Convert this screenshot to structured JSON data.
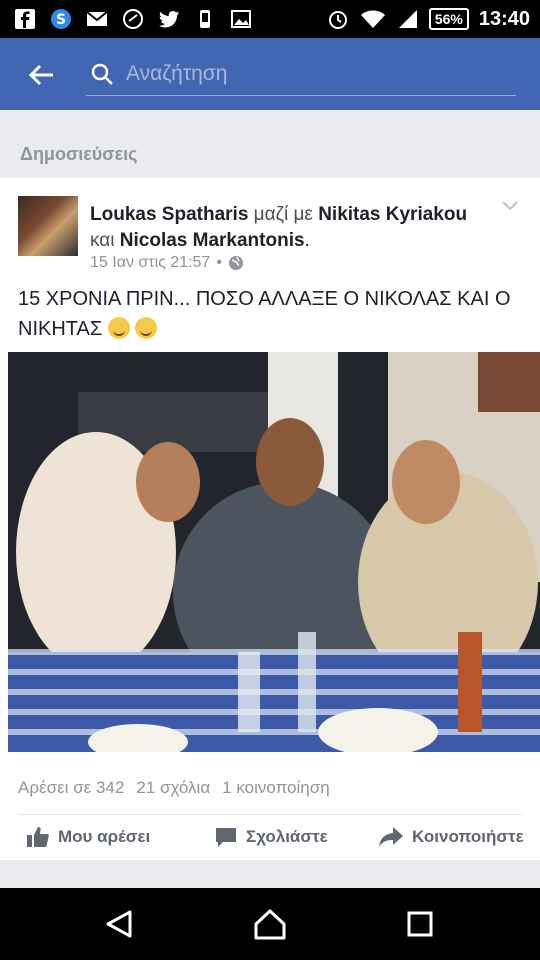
{
  "status": {
    "battery": "56%",
    "time": "13:40",
    "icons": [
      "facebook-icon",
      "skype-icon",
      "mail-icon",
      "sync-icon",
      "twitter-icon",
      "notification-icon",
      "image-icon"
    ]
  },
  "search": {
    "placeholder": "Αναζήτηση"
  },
  "section": {
    "title": "Δημοσιεύσεις"
  },
  "post": {
    "author": "Loukas Spatharis",
    "with_text": " μαζί με ",
    "tagged1": "Nikitas Kyriakou",
    "and_text": " και ",
    "tagged2": "Nicolas Markantonis",
    "end": ".",
    "date": "15 Ιαν στις 21:57",
    "separator": "•",
    "text": "15 ΧΡΟΝΙΑ ΠΡΙΝ... ΠΟΣΟ ΑΛΛΑΞΕ Ο ΝΙΚΟΛΑΣ ΚΑΙ Ο ΝΙΚΗΤΑΣ"
  },
  "stats": {
    "likes": "Αρέσει σε 342",
    "comments": "21 σχόλια",
    "shares": "1 κοινοποίηση"
  },
  "actions": {
    "like": "Μου αρέσει",
    "comment": "Σχολιάστε",
    "share": "Κοινοποιήστε"
  },
  "colors": {
    "brand": "#4267b2",
    "muted": "#90949c"
  }
}
